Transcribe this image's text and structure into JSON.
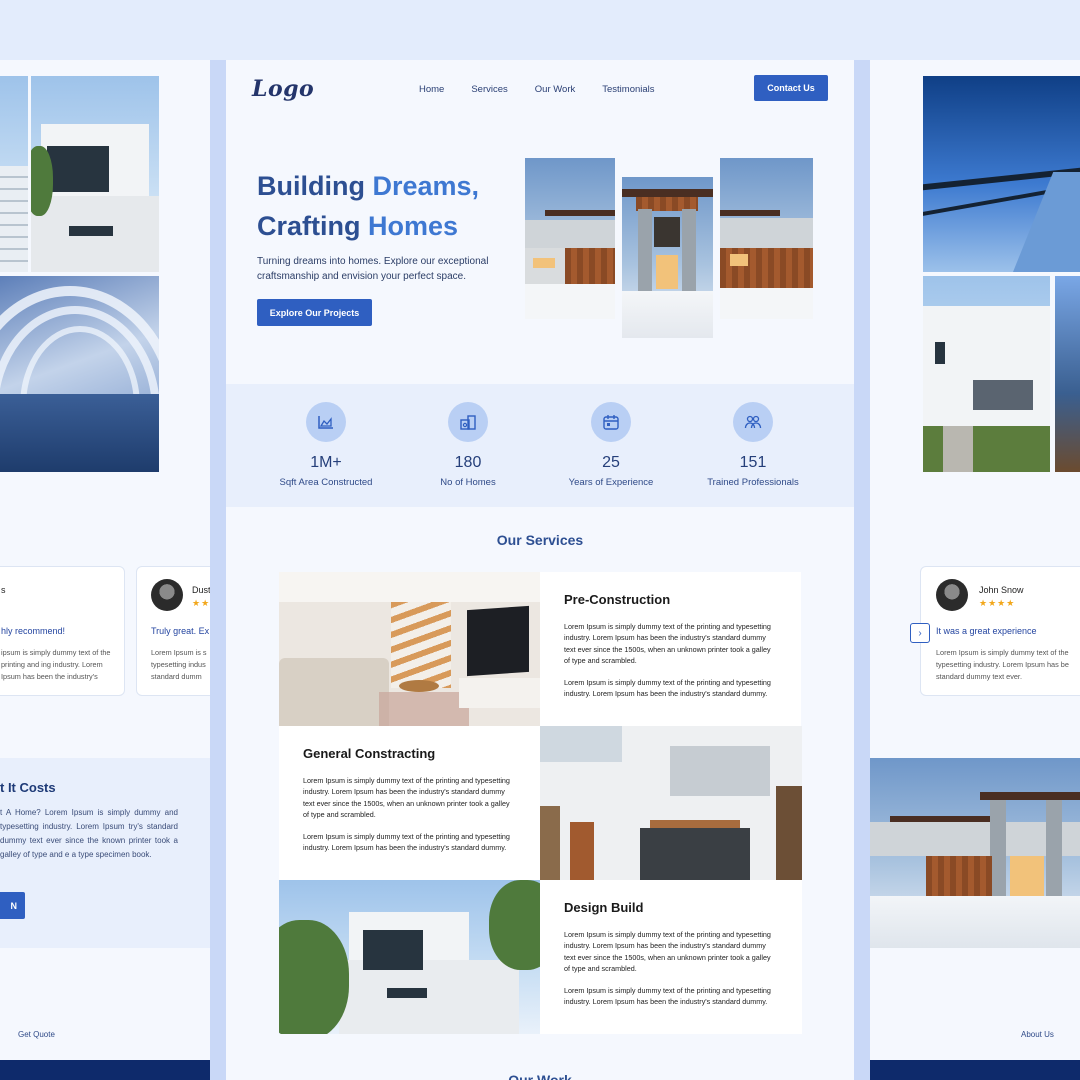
{
  "center": {
    "logo": "Logo",
    "nav": [
      "Home",
      "Services",
      "Our Work",
      "Testimonials"
    ],
    "contact_button": "Contact Us",
    "hero": {
      "title_line1_a": "Building ",
      "title_line1_b": "Dreams,",
      "title_line2_a": "Crafting ",
      "title_line2_b": "Homes",
      "subtitle": "Turning dreams into homes. Explore our exceptional craftsmanship and envision your perfect space.",
      "cta": "Explore Our Projects"
    },
    "stats": [
      {
        "icon": "area-chart-icon",
        "value": "1M+",
        "label": "Sqft Area Constructed"
      },
      {
        "icon": "homes-icon",
        "value": "180",
        "label": "No of Homes"
      },
      {
        "icon": "calendar-icon",
        "value": "25",
        "label": "Years of Experience"
      },
      {
        "icon": "team-icon",
        "value": "151",
        "label": "Trained Professionals"
      }
    ],
    "services_title": "Our Services",
    "services": [
      {
        "title": "Pre-Construction",
        "p1": "Lorem Ipsum is simply dummy text of the printing and typesetting industry. Lorem Ipsum has been the industry's standard dummy text ever since the 1500s, when an unknown printer took a galley of type and scrambled.",
        "p2": "Lorem Ipsum is simply dummy text of the printing and typesetting industry. Lorem Ipsum has been the industry's standard dummy."
      },
      {
        "title": "General Constracting",
        "p1": "Lorem Ipsum is simply dummy text of the printing and typesetting industry. Lorem Ipsum has been the industry's standard dummy text ever since the 1500s, when an unknown printer took a galley of type and scrambled.",
        "p2": "Lorem Ipsum is simply dummy text of the printing and typesetting industry. Lorem Ipsum has been the industry's standard dummy."
      },
      {
        "title": "Design Build",
        "p1": "Lorem Ipsum is simply dummy text of the printing and typesetting industry. Lorem Ipsum has been the industry's standard dummy text ever since the 1500s, when an unknown printer took a galley of type and scrambled.",
        "p2": "Lorem Ipsum is simply dummy text of the printing and typesetting industry. Lorem Ipsum has been the industry's standard dummy."
      }
    ],
    "our_work_title": "Our Work"
  },
  "left": {
    "testimonial1": {
      "name": "s",
      "quote": "hly recommend!",
      "text": "ipsum is simply dummy text of the printing and ing industry. Lorem Ipsum has been the industry's"
    },
    "testimonial2": {
      "name": "Dust",
      "stars": "★★",
      "quote": "Truly great. Ex",
      "text": "Lorem Ipsum is s typesetting indus standard dumm"
    },
    "cost": {
      "title": "t It Costs",
      "text": "t A Home? Lorem Ipsum is simply dummy and typesetting industry. Lorem Ipsum try's standard dummy text ever since the known printer took a galley of type and e a type specimen book.",
      "button": "N"
    },
    "footer_link": "Get Quote"
  },
  "right": {
    "testimonial": {
      "name": "John Snow",
      "stars": "★★★★",
      "quote": "It was a great experience",
      "text": "Lorem Ipsum is simply dummy text of the typesetting industry. Lorem Ipsum has be standard dummy text ever."
    },
    "footer_link": "About Us"
  },
  "colors": {
    "primary": "#2f5fc1",
    "heading": "#2d4f92",
    "accent": "#3e78d2",
    "footer": "#0e2a6b",
    "star": "#f2a71b"
  }
}
